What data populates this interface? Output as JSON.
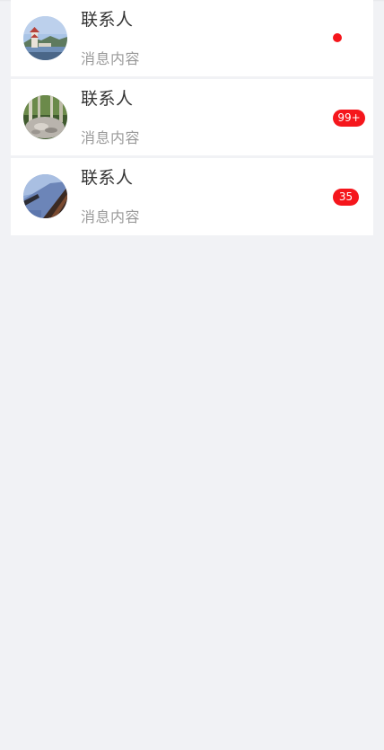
{
  "conversations": [
    {
      "avatar_icon": "avatar-photo-pagoda-lake",
      "name": "联系人",
      "message": "消息内容",
      "unread_indicator": "dot",
      "unread_count": null
    },
    {
      "avatar_icon": "avatar-photo-forest-path",
      "name": "联系人",
      "message": "消息内容",
      "unread_indicator": "badge",
      "unread_count": "99+"
    },
    {
      "avatar_icon": "avatar-photo-boardwalk",
      "name": "联系人",
      "message": "消息内容",
      "unread_indicator": "badge",
      "unread_count": "35"
    }
  ],
  "colors": {
    "page_background": "#f1f2f5",
    "row_background": "#ffffff",
    "badge_red": "#f5161c",
    "name_text": "#333333",
    "message_text": "#9a9a9a"
  }
}
